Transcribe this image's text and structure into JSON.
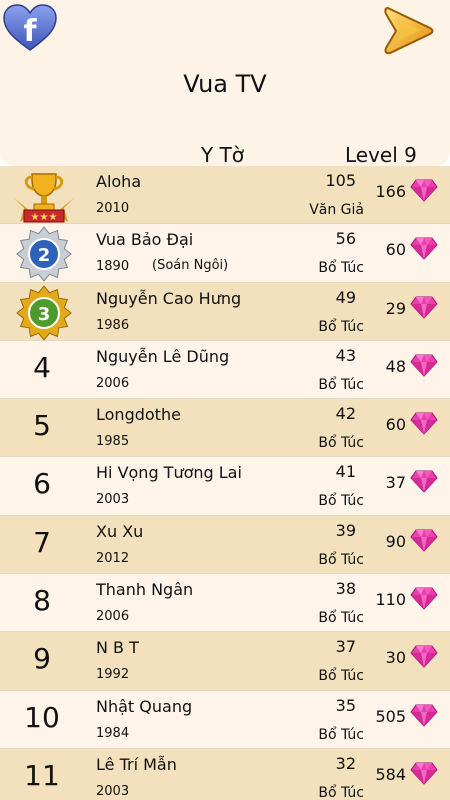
{
  "header": {
    "title": "Vua TV",
    "player_name": "Y Tờ",
    "player_level": "Level 9",
    "facebook_icon": "facebook-heart-icon",
    "play_icon": "play-arrow-icon"
  },
  "colors": {
    "header_bg": "#fdf3e6",
    "row_odd": "#f3e1bd",
    "row_even": "#fff4ea",
    "gem": "#ec3fae",
    "facebook_blue": "#4a63c4",
    "play_gold": "#f1b21c"
  },
  "rows": [
    {
      "rank": "1",
      "medal": "trophy-icon",
      "name": "Aloha",
      "year": "2010",
      "note": "",
      "level": "105",
      "title": "Văn Giả",
      "gems": "166"
    },
    {
      "rank": "2",
      "medal": "silver-medal-icon",
      "name": "Vua Bảo Đại",
      "year": "1890",
      "note": "(Soán Ngôi)",
      "level": "56",
      "title": "Bổ Túc",
      "gems": "60"
    },
    {
      "rank": "3",
      "medal": "gold-medal-icon",
      "name": "Nguyễn Cao Hưng",
      "year": "1986",
      "note": "",
      "level": "49",
      "title": "Bổ Túc",
      "gems": "29"
    },
    {
      "rank": "4",
      "name": "Nguyễn Lê Dũng",
      "year": "2006",
      "note": "",
      "level": "43",
      "title": "Bổ Túc",
      "gems": "48"
    },
    {
      "rank": "5",
      "name": "Longdothe",
      "year": "1985",
      "note": "",
      "level": "42",
      "title": "Bổ Túc",
      "gems": "60"
    },
    {
      "rank": "6",
      "name": "Hi Vọng Tương Lai",
      "year": "2003",
      "note": "",
      "level": "41",
      "title": "Bổ Túc",
      "gems": "37"
    },
    {
      "rank": "7",
      "name": "Xu Xu",
      "year": "2012",
      "note": "",
      "level": "39",
      "title": "Bổ Túc",
      "gems": "90"
    },
    {
      "rank": "8",
      "name": "Thanh Ngân",
      "year": "2006",
      "note": "",
      "level": "38",
      "title": "Bổ Túc",
      "gems": "110"
    },
    {
      "rank": "9",
      "name": "N B T",
      "year": "1992",
      "note": "",
      "level": "37",
      "title": "Bổ Túc",
      "gems": "30"
    },
    {
      "rank": "10",
      "name": "Nhật Quang",
      "year": "1984",
      "note": "",
      "level": "35",
      "title": "Bổ Túc",
      "gems": "505"
    },
    {
      "rank": "11",
      "name": "Lê Trí Mẫn",
      "year": "2003",
      "note": "",
      "level": "32",
      "title": "Bổ Túc",
      "gems": "584"
    }
  ]
}
